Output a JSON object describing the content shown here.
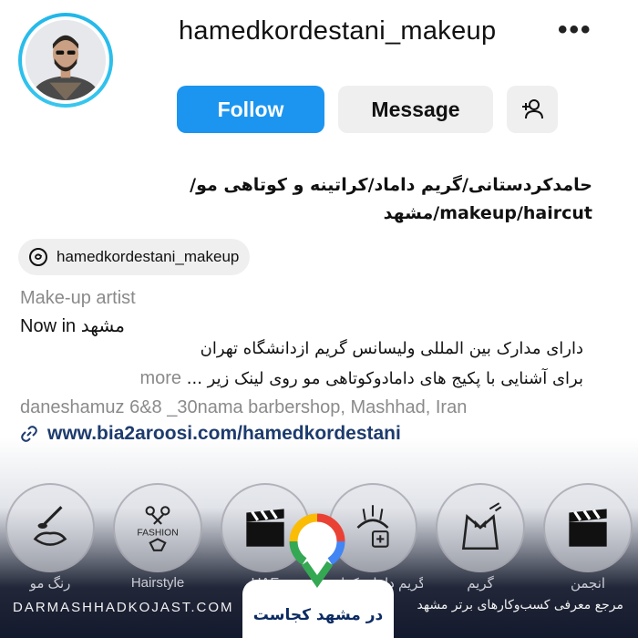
{
  "profile": {
    "username": "hamedkordestani_makeup",
    "more_icon": "more-horizontal-icon",
    "avatar_alt": "profile photo"
  },
  "actions": {
    "follow_label": "Follow",
    "message_label": "Message",
    "add_user_icon": "add-user-icon",
    "follow_color": "#1b95f0"
  },
  "bio": {
    "title_line1": "حامدکردستانی/گریم داماد/کراتینه و کوتاهی مو/",
    "title_line2": "makeup/haircut/مشهد",
    "threads_handle": "hamedkordestani_makeup",
    "category": "Make-up artist",
    "location_prefix": "Now in",
    "location_city": "مشهد",
    "line1": "دارای مدارک بین المللی ولیسانس گریم ازدانشگاه تهران",
    "line2": "برای آشنایی با پکیج های دامادوکوتاهی مو روی لینک زیر ...",
    "more_label": "more",
    "address": "daneshamuz 6&8 _30nama barbershop, Mashhad, Iran",
    "link": "www.bia2aroosi.com/hamedkordestani"
  },
  "highlights": [
    {
      "icon": "makeup-brush-icon",
      "label": "رنگ مو"
    },
    {
      "icon": "fashion-scissors-icon",
      "label": "Hairstyle"
    },
    {
      "icon": "clapperboard-icon",
      "label": "UAE"
    },
    {
      "icon": "hair-care-icon",
      "label": "گریم داماد، کراتین"
    },
    {
      "icon": "tuxedo-icon",
      "label": "گریم"
    },
    {
      "icon": "clapperboard-icon",
      "label": "انجمن"
    }
  ],
  "watermark": {
    "site": "DARMASHHADKOJAST.COM",
    "brand": "در مشهد کجاست",
    "tagline": "مرجع معرفی کسب‌وکارهای برتر مشهد"
  }
}
